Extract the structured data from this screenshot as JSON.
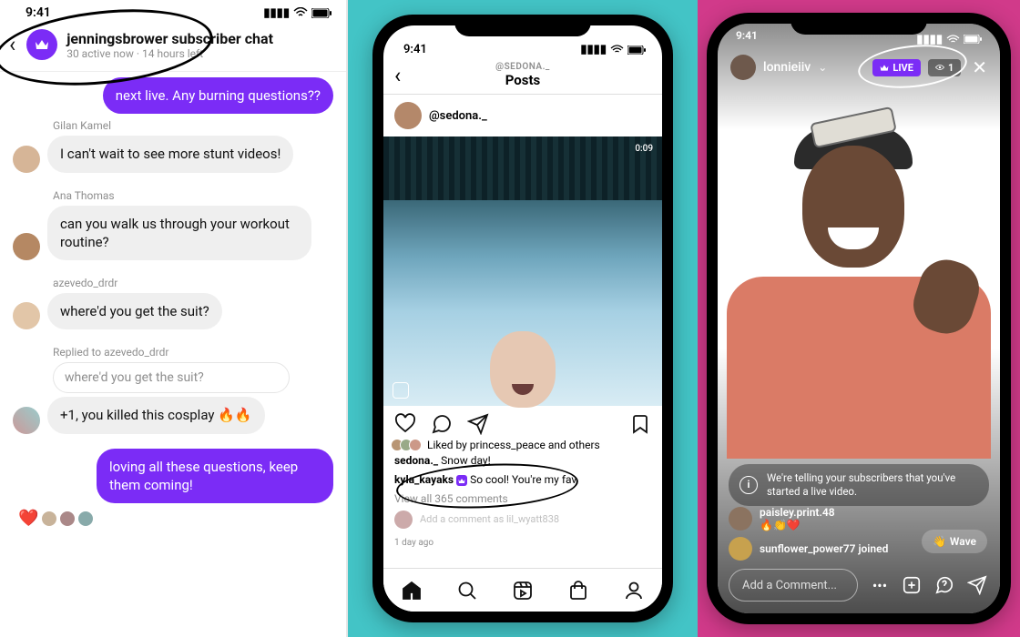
{
  "panel1": {
    "status_time": "9:41",
    "header_title": "jenningsbrower subscriber chat",
    "header_sub": "30 active now · 14 hours left",
    "self_msg_top": "next live. Any burning questions??",
    "messages": [
      {
        "name": "Gilan Kamel",
        "text": "I can't wait to see more stunt videos!"
      },
      {
        "name": "Ana Thomas",
        "text": "can you walk us through your workout routine?"
      },
      {
        "name": "azevedo_drdr",
        "text": "where'd you get the suit?"
      }
    ],
    "reply_context": "Replied to azevedo_drdr",
    "quoted_text": "where'd you get the suit?",
    "reply_text": "+1, you killed this cosplay 🔥🔥",
    "self_msg_bottom": "loving all these questions, keep them coming!",
    "reaction_emoji": "❤️"
  },
  "panel2": {
    "status_time": "9:41",
    "nav_user": "@SEDONA._",
    "nav_page": "Posts",
    "author": "@sedona._",
    "video_time": "0:09",
    "liked_by": "Liked by princess_peace and others",
    "caption_user": "sedona._",
    "caption_text": "Snow day!",
    "comment_user": "kyla_kayaks",
    "comment_text": "So cool! You're my fav",
    "view_all": "View all 365 comments",
    "add_comment_placeholder": "Add a comment as lil_wyatt838",
    "time_ago": "1 day ago"
  },
  "panel3": {
    "status_time": "9:41",
    "username": "lonnieiiv",
    "live_label": "LIVE",
    "viewer_count": "1",
    "info_text": "We're telling your subscribers that you've started a live video.",
    "comments": [
      {
        "user": "paisley.print.48",
        "text": "🔥👏❤️"
      },
      {
        "user": "sunflower_power77 joined",
        "text": ""
      }
    ],
    "wave_label": "Wave",
    "input_placeholder": "Add a Comment...",
    "more_dots": "•••"
  }
}
